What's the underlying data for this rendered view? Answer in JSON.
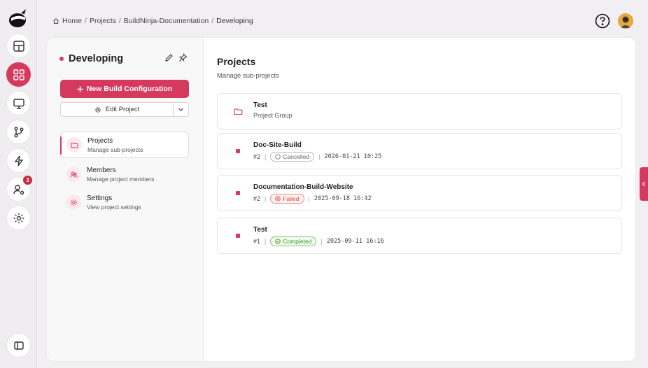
{
  "breadcrumb": {
    "items": [
      "Home",
      "Projects",
      "BuildNinja-Documentation",
      "Developing"
    ]
  },
  "sidebar_badge": "3",
  "project": {
    "name": "Developing",
    "new_build_label": "New Build Configuration",
    "edit_label": "Edit Project"
  },
  "nav": [
    {
      "title": "Projects",
      "subtitle": "Manage sub-projects"
    },
    {
      "title": "Members",
      "subtitle": "Manage project members"
    },
    {
      "title": "Settings",
      "subtitle": "View project settings"
    }
  ],
  "main": {
    "title": "Projects",
    "subtitle": "Manage sub-projects",
    "group": {
      "title": "Test",
      "subtitle": "Project Group"
    },
    "builds": [
      {
        "title": "Doc-Site-Build",
        "number": "#2",
        "status": "Cancelled",
        "time": "2026-01-21 10:25"
      },
      {
        "title": "Documentation-Build-Website",
        "number": "#2",
        "status": "Failed",
        "time": "2025-09-18 16:42"
      },
      {
        "title": "Test",
        "number": "#1",
        "status": "Completed",
        "time": "2025-09-11 16:16"
      }
    ]
  },
  "colors": {
    "accent": "#d6395e",
    "failed": "#dd4433",
    "completed": "#3a9a2a"
  },
  "icons": [
    "logo-icon",
    "dashboard-icon",
    "grid-icon",
    "monitor-icon",
    "branch-icon",
    "lightning-icon",
    "user-settings-icon",
    "gear-icon",
    "sidebar-toggle-icon",
    "help-icon",
    "pencil-icon",
    "pin-icon",
    "plus-icon",
    "chevron-down-icon",
    "folder-icon",
    "members-icon",
    "chevron-left-icon"
  ]
}
